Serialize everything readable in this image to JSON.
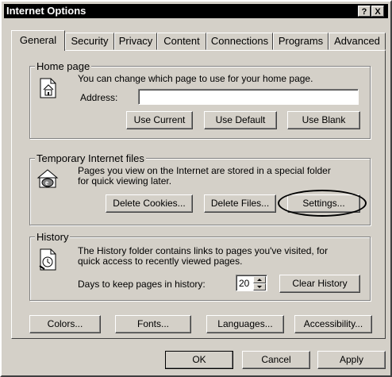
{
  "window": {
    "title": "Internet Options",
    "help_label": "?",
    "close_label": "X"
  },
  "tabs": [
    {
      "label": "General",
      "active": true
    },
    {
      "label": "Security"
    },
    {
      "label": "Privacy"
    },
    {
      "label": "Content"
    },
    {
      "label": "Connections"
    },
    {
      "label": "Programs"
    },
    {
      "label": "Advanced"
    }
  ],
  "home_page": {
    "legend": "Home page",
    "description": "You can change which page to use for your home page.",
    "address_label": "Address:",
    "address_value": "",
    "use_current": "Use Current",
    "use_default": "Use Default",
    "use_blank": "Use Blank",
    "icon": "home-page-icon"
  },
  "temp_files": {
    "legend": "Temporary Internet files",
    "description_line1": "Pages you view on the Internet are stored in a special folder",
    "description_line2": "for quick viewing later.",
    "delete_cookies": "Delete Cookies...",
    "delete_files": "Delete Files...",
    "settings": "Settings...",
    "icon": "temporary-files-icon"
  },
  "history": {
    "legend": "History",
    "description_line1": "The History folder contains links to pages you've visited, for",
    "description_line2": "quick access to recently viewed pages.",
    "days_label": "Days to keep pages in history:",
    "days_value": "20",
    "clear_history": "Clear History",
    "icon": "history-icon"
  },
  "bottom_buttons": {
    "colors": "Colors...",
    "fonts": "Fonts...",
    "languages": "Languages...",
    "accessibility": "Accessibility..."
  },
  "dialog_buttons": {
    "ok": "OK",
    "cancel": "Cancel",
    "apply": "Apply"
  }
}
